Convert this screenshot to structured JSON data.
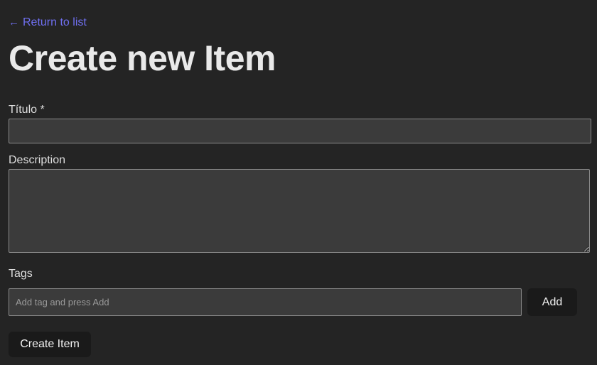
{
  "nav": {
    "back_arrow": "←",
    "back_label": "Return to list"
  },
  "page": {
    "title": "Create new Item"
  },
  "form": {
    "title_label": "Título *",
    "title_value": "",
    "description_label": "Description",
    "description_value": "",
    "tags_label": "Tags",
    "tags_placeholder": "Add tag and press Add",
    "add_button_label": "Add",
    "submit_button_label": "Create Item"
  },
  "colors": {
    "background": "#242424",
    "link": "#6f6ff0",
    "input_bg": "#3b3b3b",
    "button_bg": "#1a1a1a"
  }
}
